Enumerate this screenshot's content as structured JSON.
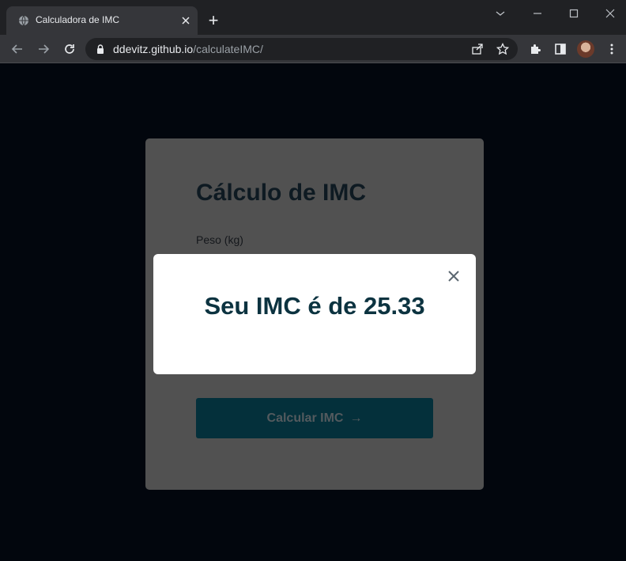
{
  "browser": {
    "tab_title": "Calculadora de IMC",
    "new_tab_symbol": "+",
    "url_domain": "ddevitz.github.io",
    "url_path": "/calculateIMC/"
  },
  "card": {
    "title": "Cálculo de IMC",
    "weight_label": "Peso (kg)",
    "button_label": "Calcular IMC",
    "button_arrow": "→"
  },
  "modal": {
    "result_text": "Seu IMC é de 25.33"
  },
  "colors": {
    "accent": "#04303b",
    "result_text": "#0c3340",
    "card_bg": "#515151",
    "page_bg": "#02060d"
  },
  "icons": [
    "globe-icon",
    "close-icon",
    "plus-icon",
    "chevron-down-icon",
    "minimize-icon",
    "maximize-icon",
    "back-icon",
    "forward-icon",
    "reload-icon",
    "lock-icon",
    "share-icon",
    "star-icon",
    "extensions-icon",
    "sidepanel-icon",
    "menu-icon"
  ]
}
